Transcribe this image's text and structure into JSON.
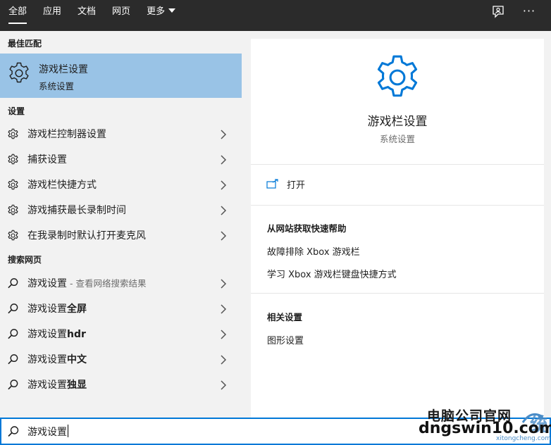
{
  "tabs": [
    {
      "label": "全部",
      "active": true
    },
    {
      "label": "应用",
      "active": false
    },
    {
      "label": "文档",
      "active": false
    },
    {
      "label": "网页",
      "active": false
    },
    {
      "label": "更多",
      "active": false
    }
  ],
  "topbar": {
    "feedback_icon": "feedback-icon",
    "more_label": "···"
  },
  "left": {
    "best_match_title": "最佳匹配",
    "best_match": {
      "title": "游戏栏设置",
      "subtitle": "系统设置",
      "icon": "gear-icon"
    },
    "settings_title": "设置",
    "settings": [
      {
        "label": "游戏栏控制器设置"
      },
      {
        "label": "捕获设置"
      },
      {
        "label": "游戏栏快捷方式"
      },
      {
        "label": "游戏捕获最长录制时间"
      },
      {
        "label": "在我录制时默认打开麦克风"
      }
    ],
    "web_title": "搜索网页",
    "web": [
      {
        "label": "游戏设置",
        "hint": " - 查看网络搜索结果",
        "strong": ""
      },
      {
        "label": "游戏设置",
        "hint": "",
        "strong": "全屏"
      },
      {
        "label": "游戏设置",
        "hint": "",
        "strong": "hdr"
      },
      {
        "label": "游戏设置",
        "hint": "",
        "strong": "中文"
      },
      {
        "label": "游戏设置",
        "hint": "",
        "strong": "独显"
      }
    ]
  },
  "right": {
    "title": "游戏栏设置",
    "subtitle": "系统设置",
    "open_label": "打开",
    "help_title": "从网站获取快速帮助",
    "help_links": [
      "故障排除 Xbox 游戏栏",
      "学习 Xbox 游戏栏键盘快捷方式"
    ],
    "related_title": "相关设置",
    "related_links": [
      "图形设置"
    ]
  },
  "search": {
    "value": "游戏设置",
    "icon": "search-icon"
  },
  "watermark": {
    "line1": "电脑公司官网",
    "line2": "dngswin10.com",
    "line3": "xitongcheng.com"
  },
  "colors": {
    "accent": "#0078d7",
    "selection": "#99c3e6",
    "topbar": "#2b2b2b"
  }
}
